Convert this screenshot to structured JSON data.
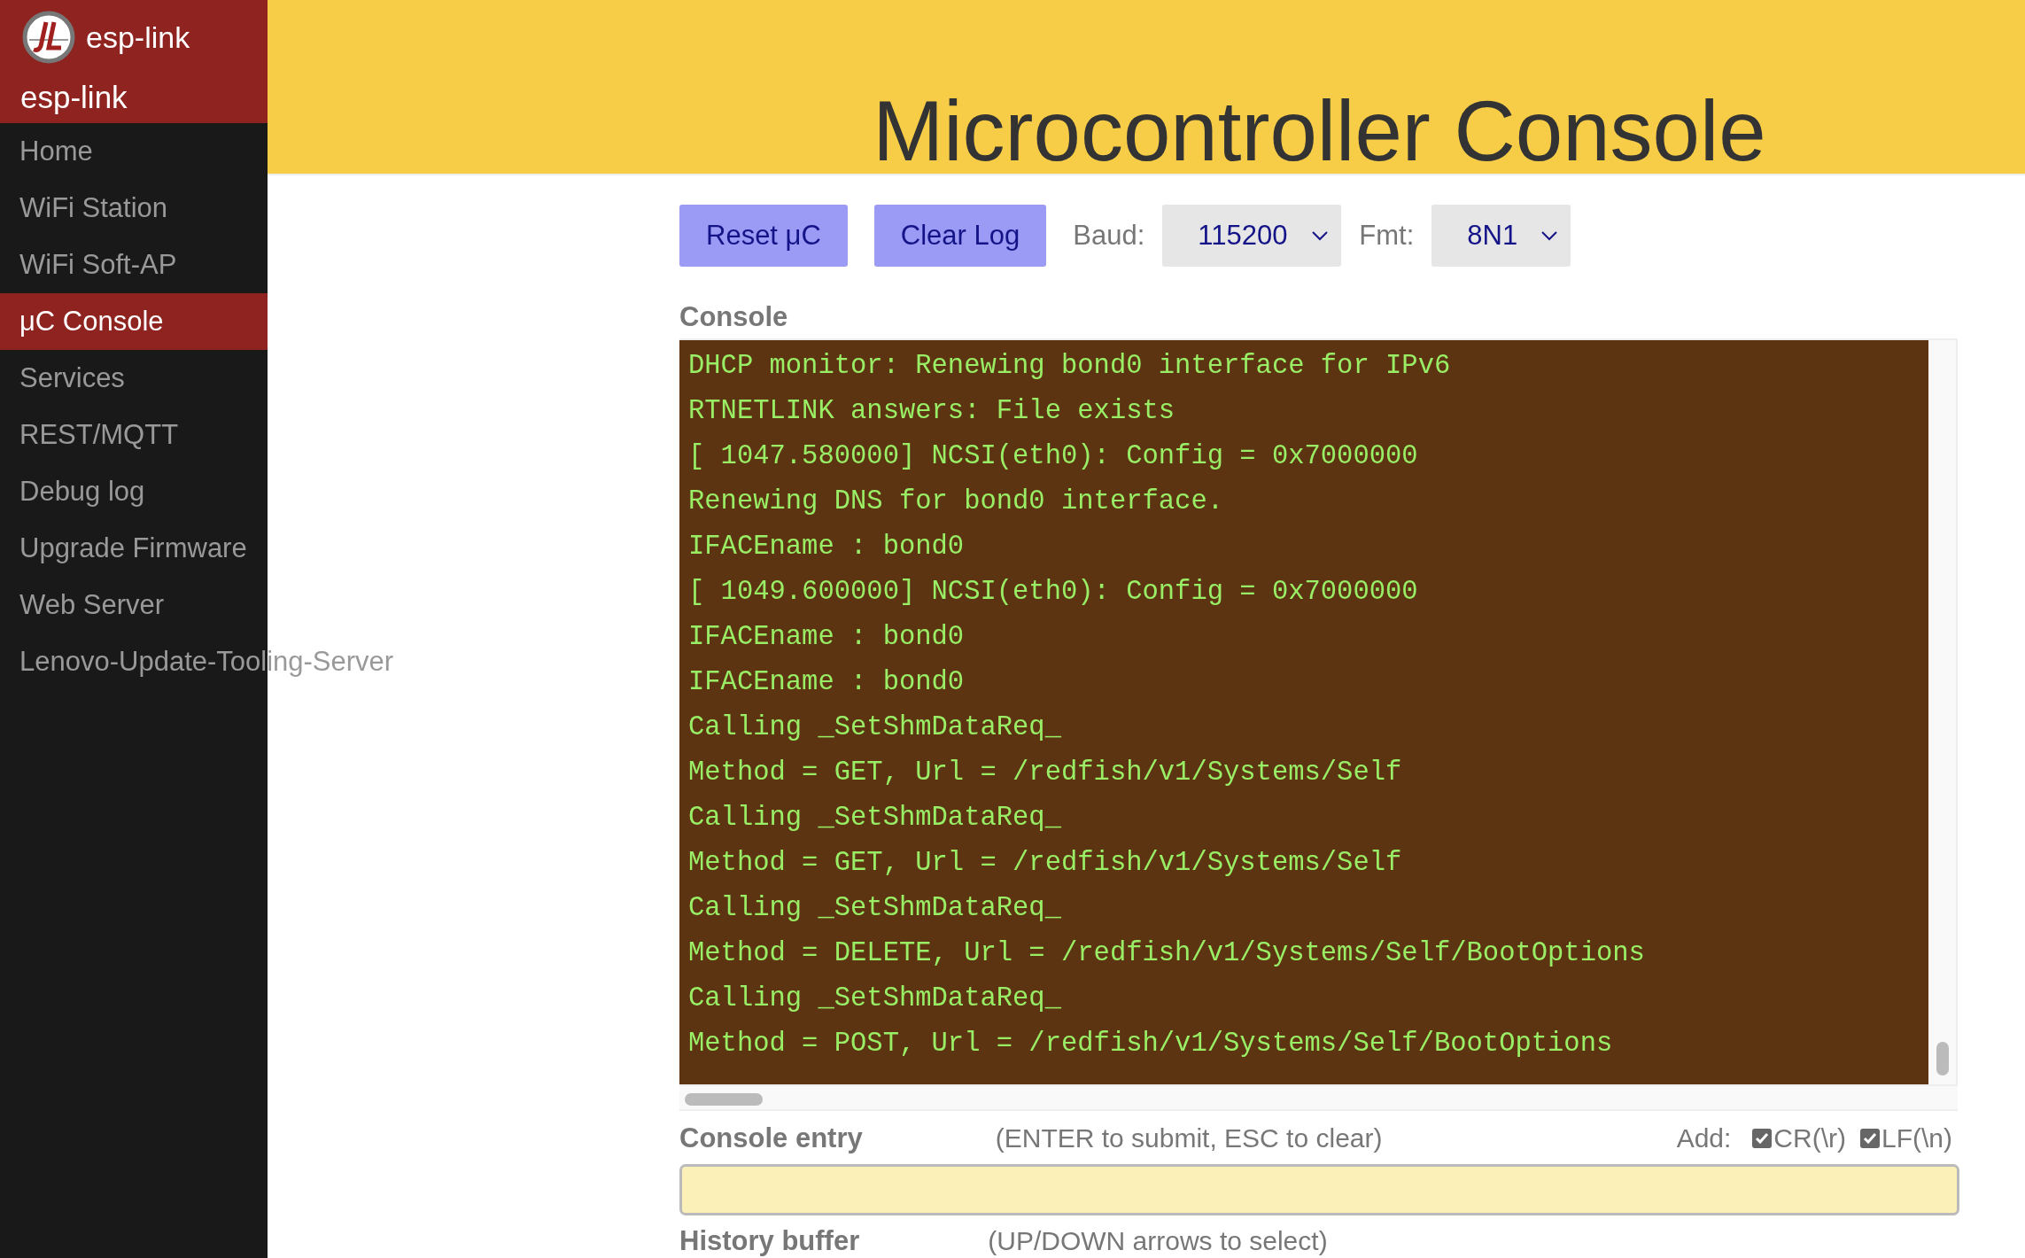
{
  "sidebar": {
    "brand": "esp-link",
    "title": "esp-link",
    "items": [
      {
        "label": "Home",
        "selected": false
      },
      {
        "label": "WiFi Station",
        "selected": false
      },
      {
        "label": "WiFi Soft-AP",
        "selected": false
      },
      {
        "label": "μC Console",
        "selected": true
      },
      {
        "label": "Services",
        "selected": false
      },
      {
        "label": "REST/MQTT",
        "selected": false
      },
      {
        "label": "Debug log",
        "selected": false
      },
      {
        "label": "Upgrade Firmware",
        "selected": false
      },
      {
        "label": "Web Server",
        "selected": false
      },
      {
        "label": "Lenovo-Update-Tooling-Server",
        "selected": false
      }
    ]
  },
  "header": {
    "title": "Microcontroller Console"
  },
  "toolbar": {
    "buttons": [
      "Reset μC",
      "Clear Log"
    ],
    "baud": {
      "label": "Baud:",
      "value": "115200"
    },
    "fmt": {
      "label": "Fmt:",
      "value": "8N1"
    }
  },
  "console": {
    "label": "Console",
    "lines": [
      "DHCP monitor: Renewing bond0 interface for IPv6",
      "RTNETLINK answers: File exists",
      "[ 1047.580000] NCSI(eth0): Config = 0x7000000",
      "Renewing DNS for bond0 interface.",
      "IFACEname : bond0",
      "[ 1049.600000] NCSI(eth0): Config = 0x7000000",
      "IFACEname : bond0",
      "IFACEname : bond0",
      "Calling _SetShmDataReq_",
      "Method = GET, Url = /redfish/v1/Systems/Self",
      "Calling _SetShmDataReq_",
      "Method = GET, Url = /redfish/v1/Systems/Self",
      "Calling _SetShmDataReq_",
      "Method = DELETE, Url = /redfish/v1/Systems/Self/BootOptions",
      "Calling _SetShmDataReq_",
      "Method = POST, Url = /redfish/v1/Systems/Self/BootOptions"
    ]
  },
  "entry": {
    "label": "Console entry",
    "hint": "(ENTER to submit, ESC to clear)",
    "add_label": "Add:",
    "options": [
      {
        "label": "CR(\\r)",
        "checked": true
      },
      {
        "label": "LF(\\n)",
        "checked": true
      }
    ]
  },
  "history": {
    "label": "History buffer",
    "hint": "(UP/DOWN arrows to select)"
  }
}
